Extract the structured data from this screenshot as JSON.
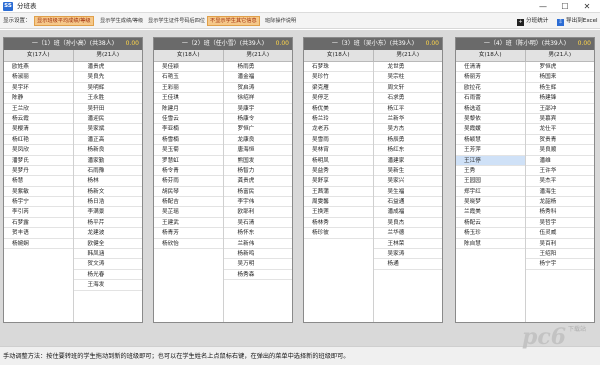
{
  "window": {
    "app_icon_text": "SS",
    "title": "分班表",
    "min_label": "—",
    "max_label": "☐",
    "close_label": "✕"
  },
  "toolbar": {
    "label": "显示设置：",
    "buttons": [
      {
        "label": "显示班级平均成绩/等级",
        "highlight": true
      },
      {
        "label": "显示学生成绩/等级",
        "highlight": false
      },
      {
        "label": "显示学生证件号码后四位",
        "highlight": false
      },
      {
        "label": "不显示学生其它信息",
        "highlight": true
      },
      {
        "label": "班际操作说明",
        "highlight": false
      }
    ],
    "stats_label": "分班统计",
    "stats_icon": "+",
    "export_label": "导出到Excel",
    "export_icon": "⇩"
  },
  "panels": [
    {
      "title": "一（1）班（孙小高）(共38人)",
      "score": "0.00",
      "girls_header": "女(17人)",
      "boys_header": "男(21人)",
      "girls": [
        "欧姓燕",
        "杨淑丽",
        "吴宇环",
        "陈静",
        "王兰欣",
        "杨云霞",
        "吴樱清",
        "杨红艳",
        "吴凤欣",
        "潘梦氏",
        "吴梦丹",
        "杨慧",
        "吴紫敏",
        "杨宇宁",
        "李引芮",
        "石梦露",
        "贺丰语",
        "杨婉娴"
      ],
      "boys": [
        "潘贵虎",
        "吴良先",
        "吴明辉",
        "王永胜",
        "吴轩田",
        "潘迎民",
        "吴家斌",
        "潘正高",
        "杨新良",
        "潘家勤",
        "石雨豫",
        "杨林",
        "杨新文",
        "杨日浩",
        "李满景",
        "杨平芹",
        "龙建波",
        "欧健全",
        "韩凤涵",
        "贺文涛",
        "杨光春",
        "王海发"
      ],
      "selected_girl": -1
    },
    {
      "title": "一（2）班（任小雪）(共39人)",
      "score": "0.00",
      "girls_header": "女(18人)",
      "boys_header": "男(21人)",
      "girls": [
        "吴佳颖",
        "石艳玉",
        "王彩丽",
        "王佳琪",
        "陈建月",
        "佳雪云",
        "李亚楠",
        "杨雪楠",
        "吴玉菊",
        "罗慧虹",
        "杨令青",
        "杨芬雨",
        "胡民琴",
        "杨配吉",
        "吴芷瑶",
        "王建武",
        "杨青芳",
        "杨欣怡"
      ],
      "boys": [
        "杨雨勇",
        "潘金福",
        "贺启涛",
        "徐绍祥",
        "吴康宇",
        "杨康令",
        "罗恒广",
        "龙康良",
        "唐海恒",
        "熊国发",
        "杨智力",
        "龚贵虎",
        "杨富民",
        "李宇伟",
        "欧耶利",
        "吴石清",
        "杨怀东",
        "兰新伟",
        "杨新鸣",
        "吴万明",
        "杨秀森"
      ],
      "selected_girl": -1
    },
    {
      "title": "一（3）班（吴小东）(共39人)",
      "score": "0.00",
      "girls_header": "女(18人)",
      "boys_header": "男(21人)",
      "girls": [
        "石梦珠",
        "吴珍竹",
        "梁克雁",
        "吴停芝",
        "杨优美",
        "杨兰玲",
        "龙老苏",
        "吴雪雨",
        "吴林宵",
        "杨明凤",
        "吴益秀",
        "吴舒享",
        "王茜蒲",
        "周雯馨",
        "王换莲",
        "杨林秀",
        "杨珍彼"
      ],
      "boys": [
        "龙世勇",
        "吴宗柱",
        "周文轩",
        "石求勇",
        "杨江平",
        "兰新华",
        "吴方杰",
        "杨辰勇",
        "杨红东",
        "潘建家",
        "吴新生",
        "吴家兴",
        "吴生福",
        "石益通",
        "潘成福",
        "吴良杰",
        "兰华德",
        "王林荣",
        "吴家涛",
        "杨通"
      ],
      "selected_girl": -1
    },
    {
      "title": "一（4）班（陈小明）(共39人)",
      "score": "0.00",
      "girls_header": "女(18人)",
      "boys_header": "男(21人)",
      "girls": [
        "任清清",
        "杨丽芳",
        "欧拉花",
        "石雨蕾",
        "杨选道",
        "吴黎依",
        "吴霞媛",
        "杨颖慧",
        "王芳萍",
        "王江停",
        "王秀",
        "王园园",
        "郑宇红",
        "吴晓梦",
        "兰霞美",
        "杨配云",
        "杨玉珍",
        "陈自慧"
      ],
      "boys": [
        "罗恒虎",
        "杨国来",
        "杨生辉",
        "杨建锋",
        "王邵冲",
        "吴慕宾",
        "龙仕平",
        "贺贵青",
        "吴良顺",
        "潘维",
        "王许华",
        "吴杰平",
        "潘海生",
        "龙韶杨",
        "杨秀科",
        "吴哲宇",
        "伍灵威",
        "吴百利",
        "王绍阳",
        "杨宁宇"
      ],
      "selected_girl": 9
    }
  ],
  "status": {
    "text": "手动调整方法：按住要转班的学生拖动到新的班级即可；也可以在学生姓名上点鼠标右键，在弹出的菜单中选择新的班级即可。"
  },
  "watermark": {
    "logo": "pc6",
    "sub": "下载站"
  }
}
